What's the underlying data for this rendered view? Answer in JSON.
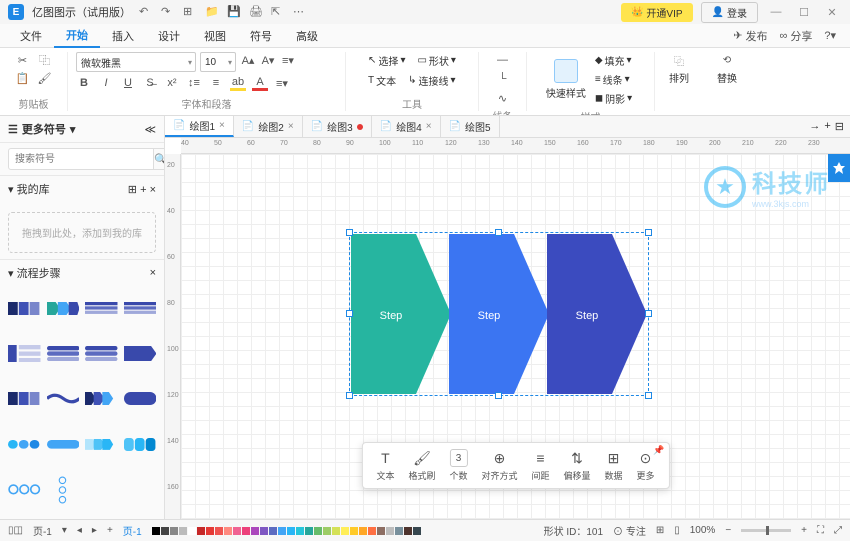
{
  "title_bar": {
    "app_name": "亿图图示（试用版）",
    "vip_btn": "开通VIP",
    "login_btn": "登录"
  },
  "menu": {
    "items": [
      "文件",
      "开始",
      "插入",
      "设计",
      "视图",
      "符号",
      "高级"
    ],
    "publish": "发布",
    "share": "分享"
  },
  "ribbon": {
    "clipboard_label": "剪贴板",
    "font_name": "微软雅黑",
    "font_size": "10",
    "font_label": "字体和段落",
    "select_btn": "选择",
    "shape_btn": "形状",
    "text_btn": "文本",
    "connector_btn": "连接线",
    "tools_label": "工具",
    "lines_label": "线条",
    "quickstyle": "快速样式",
    "fill": "填充",
    "line": "线条",
    "shadow": "阴影",
    "style_label": "样式",
    "arrange": "排列",
    "replace": "替换"
  },
  "left_panel": {
    "more_symbols": "更多符号",
    "search_placeholder": "搜索符号",
    "my_lib": "我的库",
    "drop_hint": "拖拽到此处，添加到我的库",
    "flow_steps": "流程步骤"
  },
  "doc_tabs": [
    "绘图1",
    "绘图2",
    "绘图3",
    "绘图4",
    "绘图5"
  ],
  "ruler_h": [
    "40",
    "50",
    "60",
    "70",
    "80",
    "90",
    "100",
    "110",
    "120",
    "130",
    "140",
    "150",
    "160",
    "170",
    "180",
    "190",
    "200",
    "210",
    "220",
    "230"
  ],
  "ruler_v": [
    "20",
    "40",
    "60",
    "80",
    "100",
    "120",
    "140",
    "160"
  ],
  "watermark": {
    "title": "科技师",
    "sub": "www.3kjs.com"
  },
  "shapes": {
    "step1": "Step",
    "step2": "Step",
    "step3": "Step"
  },
  "float_toolbar": {
    "text": "文本",
    "format": "格式刷",
    "count_val": "3",
    "count": "个数",
    "align": "对齐方式",
    "gap": "间距",
    "offset": "偏移量",
    "data": "数据",
    "more": "更多"
  },
  "status": {
    "page_label": "页-1",
    "page_label2": "页-1",
    "shape_id_label": "形状 ID：",
    "shape_id": "101",
    "focus": "专注",
    "zoom": "100%"
  },
  "colors": [
    "#000",
    "#444",
    "#888",
    "#bbb",
    "#fff",
    "#c62828",
    "#e53935",
    "#ef5350",
    "#ff8a80",
    "#f06292",
    "#ec407a",
    "#ab47bc",
    "#7e57c2",
    "#5c6bc0",
    "#42a5f5",
    "#29b6f6",
    "#26c6da",
    "#26a69a",
    "#66bb6a",
    "#9ccc65",
    "#d4e157",
    "#ffee58",
    "#ffca28",
    "#ffa726",
    "#ff7043",
    "#8d6e63",
    "#bdbdbd",
    "#78909c",
    "#4e342e",
    "#37474f"
  ]
}
